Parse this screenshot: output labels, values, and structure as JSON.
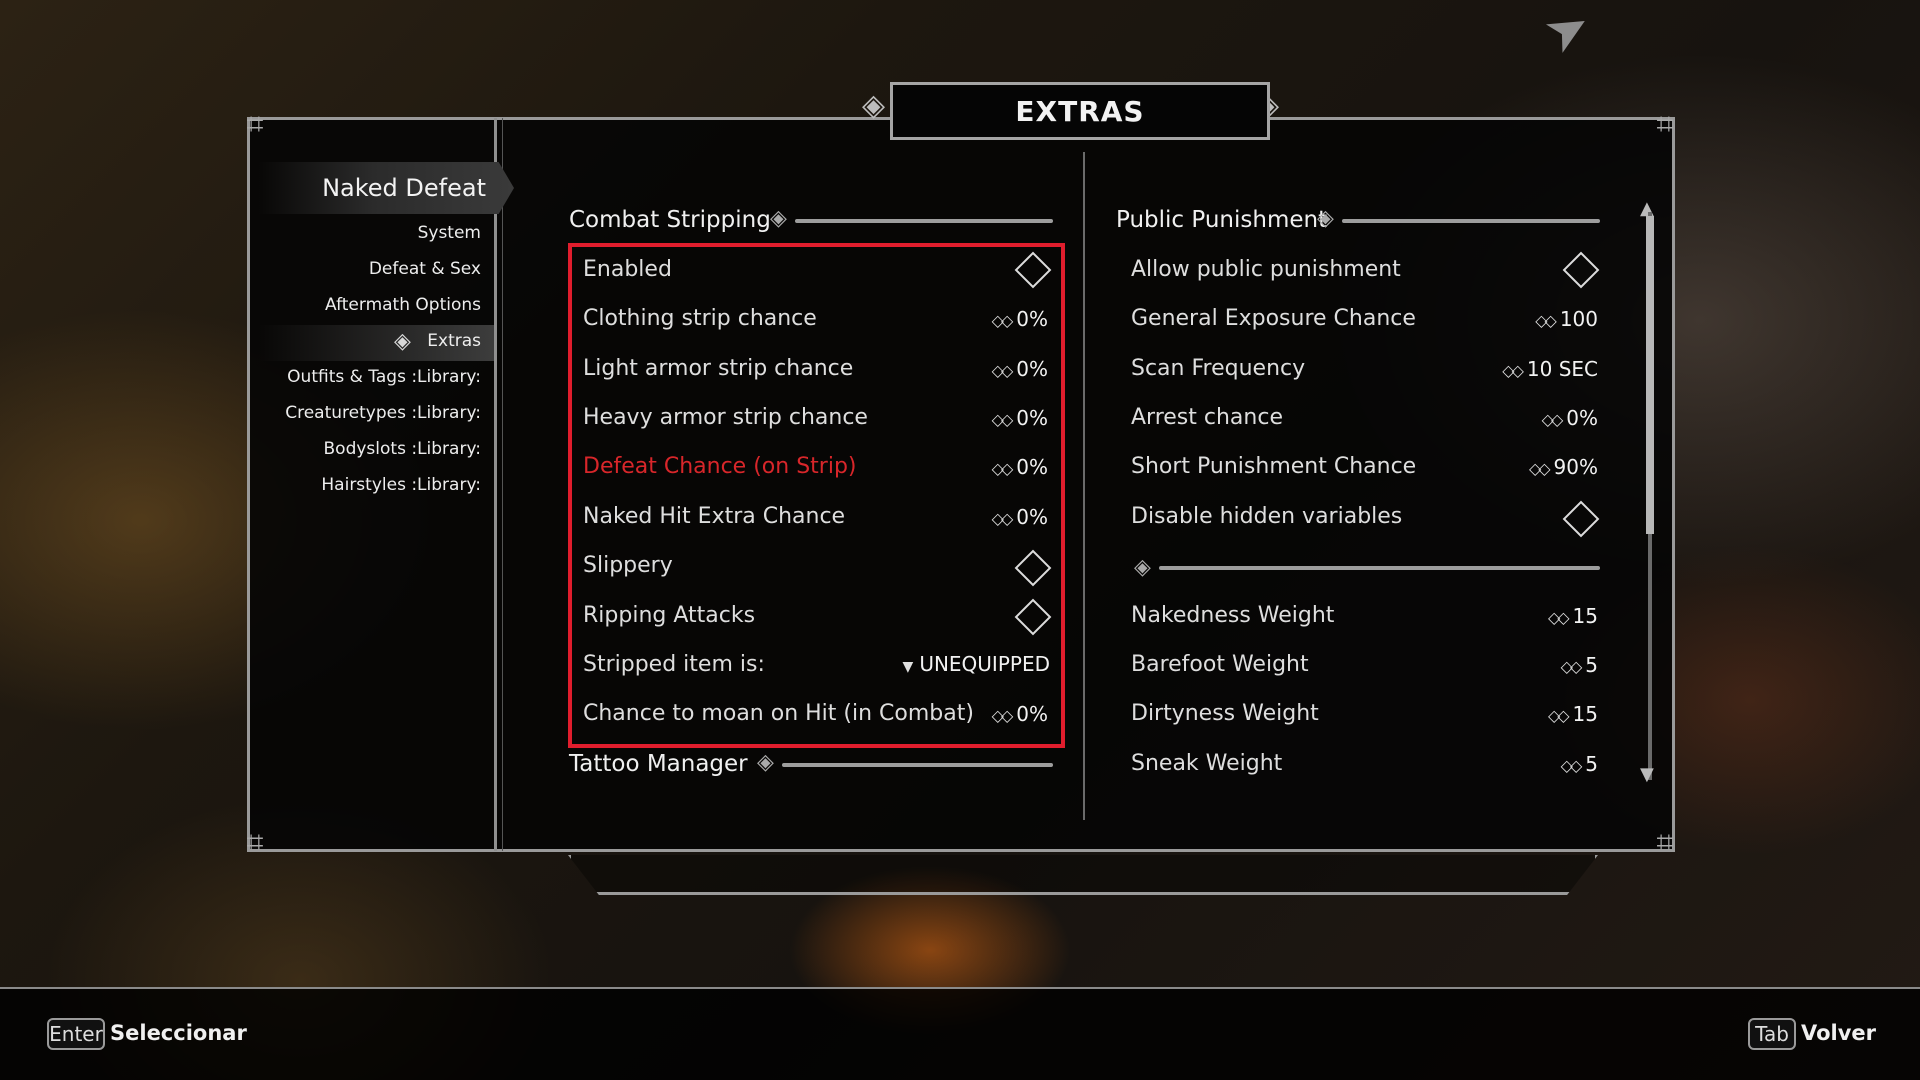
{
  "window": {
    "title": "EXTRAS"
  },
  "sidebar": {
    "mod_name": "Naked Defeat",
    "items": [
      {
        "label": "System"
      },
      {
        "label": "Defeat & Sex"
      },
      {
        "label": "Aftermath Options"
      },
      {
        "label": "Extras",
        "selected": true
      },
      {
        "label": "Outfits & Tags :Library:"
      },
      {
        "label": "Creaturetypes :Library:"
      },
      {
        "label": "Bodyslots :Library:"
      },
      {
        "label": "Hairstyles :Library:"
      }
    ]
  },
  "left_column": {
    "header": "Combat Stripping",
    "options": [
      {
        "label": "Enabled",
        "type": "toggle"
      },
      {
        "label": "Clothing strip chance",
        "type": "slider",
        "value": "0%"
      },
      {
        "label": "Light armor strip chance",
        "type": "slider",
        "value": "0%"
      },
      {
        "label": "Heavy armor strip chance",
        "type": "slider",
        "value": "0%"
      },
      {
        "label": "Defeat Chance (on Strip)",
        "type": "slider",
        "value": "0%",
        "highlighted": true
      },
      {
        "label": "Naked Hit Extra Chance",
        "type": "slider",
        "value": "0%"
      },
      {
        "label": "Slippery",
        "type": "toggle"
      },
      {
        "label": "Ripping Attacks",
        "type": "toggle"
      },
      {
        "label": "Stripped item is:",
        "type": "menu",
        "value": "UNEQUIPPED"
      },
      {
        "label": "Chance to moan on Hit (in Combat)",
        "type": "slider",
        "value": "0%"
      }
    ],
    "footer_header": "Tattoo Manager"
  },
  "right_column": {
    "header": "Public Punishment",
    "options": [
      {
        "label": "Allow public punishment",
        "type": "toggle"
      },
      {
        "label": "General Exposure Chance",
        "type": "slider",
        "value": "100"
      },
      {
        "label": "Scan Frequency",
        "type": "slider",
        "value": "10 SEC"
      },
      {
        "label": "Arrest chance",
        "type": "slider",
        "value": "0%"
      },
      {
        "label": "Short Punishment Chance",
        "type": "slider",
        "value": "90%"
      },
      {
        "label": "Disable hidden variables",
        "type": "toggle"
      }
    ],
    "options_after_divider": [
      {
        "label": "Nakedness Weight",
        "type": "slider",
        "value": "15"
      },
      {
        "label": "Barefoot Weight",
        "type": "slider",
        "value": "5"
      },
      {
        "label": "Dirtyness Weight",
        "type": "slider",
        "value": "15"
      },
      {
        "label": "Sneak Weight",
        "type": "slider",
        "value": "5"
      }
    ]
  },
  "bottom_bar": {
    "select_key": "Enter",
    "select_label": "Seleccionar",
    "back_key": "Tab",
    "back_label": "Volver"
  },
  "colors": {
    "highlight_red": "#d8262a",
    "box_red": "#e01d2d",
    "frame_gray": "#9a9a9a"
  },
  "icons": {
    "slider": "double-diamond-icon",
    "toggle": "diamond-checkbox-icon",
    "menu": "triangle-down-icon",
    "cursor": "arrow-cursor-icon"
  }
}
